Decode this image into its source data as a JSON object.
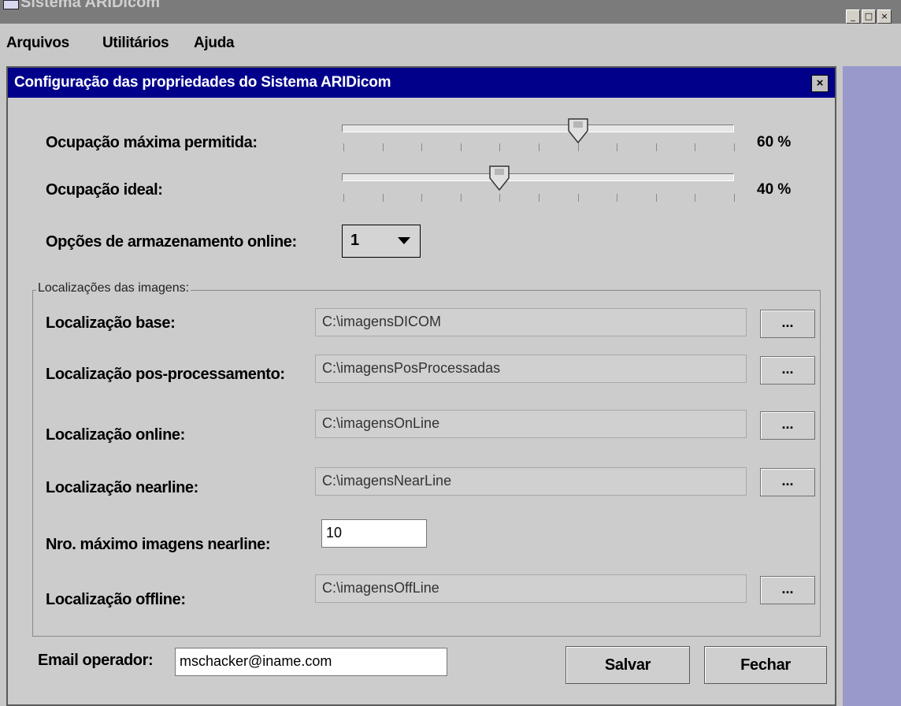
{
  "window": {
    "title": "Sistema ARIDicom",
    "minimize_glyph": "_",
    "maximize_glyph": "□",
    "close_glyph": "×"
  },
  "menubar": {
    "items": [
      {
        "label": "Arquivos"
      },
      {
        "label": "Utilitários"
      },
      {
        "label": "Ajuda"
      }
    ]
  },
  "dialog": {
    "title": "Configuração das propriedades do Sistema ARIDicom",
    "close_glyph": "×",
    "max_occupancy": {
      "label": "Ocupação máxima permitida:",
      "value_text": "60 %",
      "value": 60
    },
    "ideal_occupancy": {
      "label": "Ocupação ideal:",
      "value_text": "40 %",
      "value": 40
    },
    "storage_options": {
      "label": "Opções de armazenamento online:",
      "selected": "1"
    },
    "locations_group": {
      "title": "Localizações das imagens:",
      "base": {
        "label": "Localização base:",
        "value": "C:\\imagensDICOM",
        "browse": "..."
      },
      "post": {
        "label": "Localização pos-processamento:",
        "value": "C:\\imagensPosProcessadas",
        "browse": "..."
      },
      "online": {
        "label": "Localização online:",
        "value": "C:\\imagensOnLine",
        "browse": "..."
      },
      "nearline": {
        "label": "Localização nearline:",
        "value": "C:\\imagensNearLine",
        "browse": "..."
      },
      "max_nearline": {
        "label": "Nro. máximo imagens nearline:",
        "value": "10"
      },
      "offline": {
        "label": "Localização offline:",
        "value": "C:\\imagensOffLine",
        "browse": "..."
      }
    },
    "email": {
      "label": "Email operador:",
      "value": "mschacker@iname.com"
    },
    "save_button": "Salvar",
    "close_button": "Fechar"
  }
}
